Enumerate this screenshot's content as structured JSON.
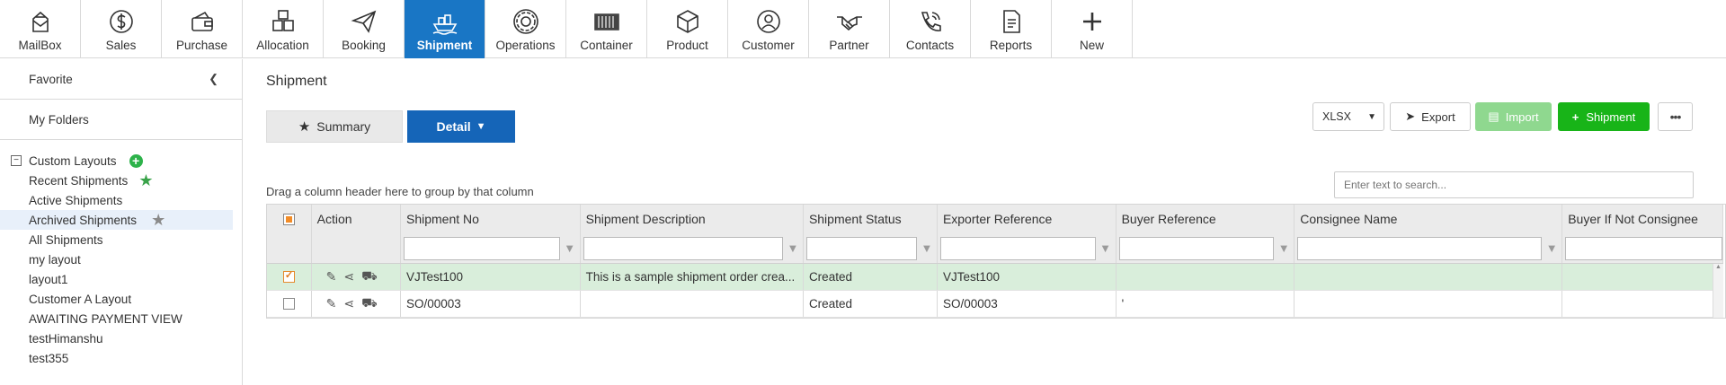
{
  "nav": [
    {
      "label": "MailBox",
      "icon": "mailbox-icon",
      "active": false
    },
    {
      "label": "Sales",
      "icon": "dollar-icon",
      "active": false
    },
    {
      "label": "Purchase",
      "icon": "wallet-icon",
      "active": false
    },
    {
      "label": "Allocation",
      "icon": "boxes-icon",
      "active": false
    },
    {
      "label": "Booking",
      "icon": "paper-plane-icon",
      "active": false
    },
    {
      "label": "Shipment",
      "icon": "ship-icon",
      "active": true
    },
    {
      "label": "Operations",
      "icon": "gear-icon",
      "active": false
    },
    {
      "label": "Container",
      "icon": "container-icon",
      "active": false
    },
    {
      "label": "Product",
      "icon": "box-icon",
      "active": false
    },
    {
      "label": "Customer",
      "icon": "user-icon",
      "active": false
    },
    {
      "label": "Partner",
      "icon": "handshake-icon",
      "active": false
    },
    {
      "label": "Contacts",
      "icon": "phone-icon",
      "active": false
    },
    {
      "label": "Reports",
      "icon": "document-icon",
      "active": false
    },
    {
      "label": "New",
      "icon": "plus-icon",
      "active": false
    }
  ],
  "sidebar": {
    "favorite": "Favorite",
    "my_folders": "My Folders",
    "custom_layouts": "Custom Layouts",
    "items": [
      {
        "label": "Recent Shipments",
        "star": "green"
      },
      {
        "label": "Active Shipments",
        "star": ""
      },
      {
        "label": "Archived Shipments",
        "star": "gray",
        "selected": true
      },
      {
        "label": "All Shipments",
        "star": ""
      },
      {
        "label": "my layout",
        "star": ""
      },
      {
        "label": "layout1",
        "star": ""
      },
      {
        "label": "Customer A Layout",
        "star": ""
      },
      {
        "label": "AWAITING PAYMENT VIEW",
        "star": ""
      },
      {
        "label": "testHimanshu",
        "star": ""
      },
      {
        "label": "test355",
        "star": ""
      }
    ]
  },
  "main": {
    "title": "Shipment",
    "summary_label": "Summary",
    "detail_label": "Detail",
    "format_value": "XLSX",
    "export_label": "Export",
    "import_label": "Import",
    "new_shipment_label": "Shipment",
    "group_hint": "Drag a column header here to group by that column",
    "search_placeholder": "Enter text to search..."
  },
  "grid": {
    "columns": [
      "Action",
      "Shipment No",
      "Shipment Description",
      "Shipment Status",
      "Exporter Reference",
      "Buyer Reference",
      "Consignee Name",
      "Buyer If Not Consignee"
    ],
    "rows": [
      {
        "checked": true,
        "shipment_no": "VJTest100",
        "description": "This is a sample shipment order crea...",
        "status": "Created",
        "exporter_ref": "VJTest100",
        "buyer_ref": "",
        "consignee": "",
        "buyer_if_not": ""
      },
      {
        "checked": false,
        "shipment_no": "SO/00003",
        "description": "",
        "status": "Created",
        "exporter_ref": "SO/00003",
        "buyer_ref": "'",
        "consignee": "",
        "buyer_if_not": ""
      }
    ]
  }
}
